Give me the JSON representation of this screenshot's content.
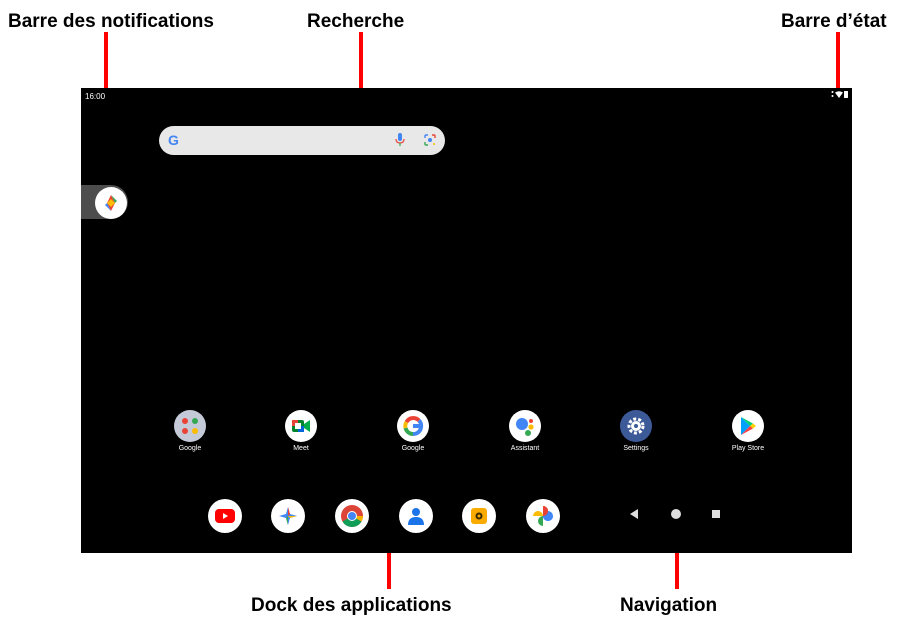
{
  "callouts": {
    "notifications": "Barre des notifications",
    "search": "Recherche",
    "status": "Barre d’état",
    "dock": "Dock des applications",
    "navigation": "Navigation"
  },
  "status_bar": {
    "time": "16:00"
  },
  "search_bar": {
    "logo": "G"
  },
  "apps": [
    {
      "label": "Google",
      "icon": "google-folder-icon"
    },
    {
      "label": "Meet",
      "icon": "meet-icon"
    },
    {
      "label": "Google",
      "icon": "google-icon"
    },
    {
      "label": "Assistant",
      "icon": "assistant-icon"
    },
    {
      "label": "Settings",
      "icon": "settings-icon"
    },
    {
      "label": "Play Store",
      "icon": "play-store-icon"
    }
  ],
  "dock": [
    "youtube-icon",
    "gemini-icon",
    "chrome-icon",
    "contacts-icon",
    "files-icon",
    "photos-icon"
  ],
  "navigation": [
    "back-icon",
    "home-icon",
    "recents-icon"
  ],
  "colors": {
    "screen": "#000000",
    "callout_line": "#ff0000"
  }
}
